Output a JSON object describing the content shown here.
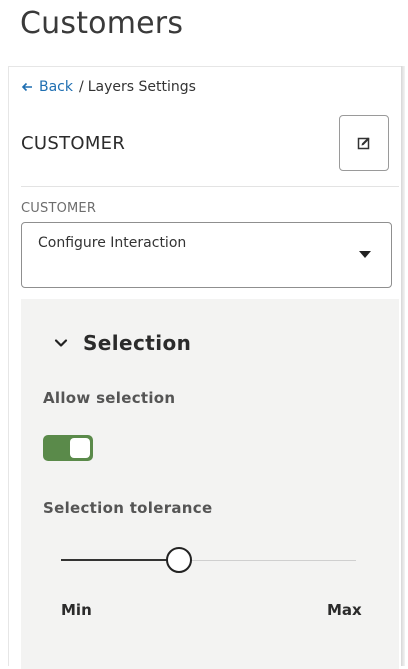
{
  "page": {
    "title": "Customers"
  },
  "breadcrumb": {
    "back_label": "Back",
    "separator": "/",
    "current": "Layers Settings"
  },
  "layer": {
    "name": "CUSTOMER",
    "edit_icon": "edit-icon"
  },
  "config": {
    "field_label": "CUSTOMER",
    "selected_value": "Configure Interaction",
    "caret_icon": "caret-down-icon"
  },
  "selection_section": {
    "title": "Selection",
    "expanded": true,
    "allow_selection_label": "Allow selection",
    "allow_selection_on": true,
    "tolerance_label": "Selection tolerance",
    "tolerance_value": 0.4,
    "min_label": "Min",
    "max_label": "Max"
  },
  "colors": {
    "link": "#1f6fb2",
    "toggle_on": "#5a8a4a",
    "section_bg": "#f3f3f2"
  }
}
